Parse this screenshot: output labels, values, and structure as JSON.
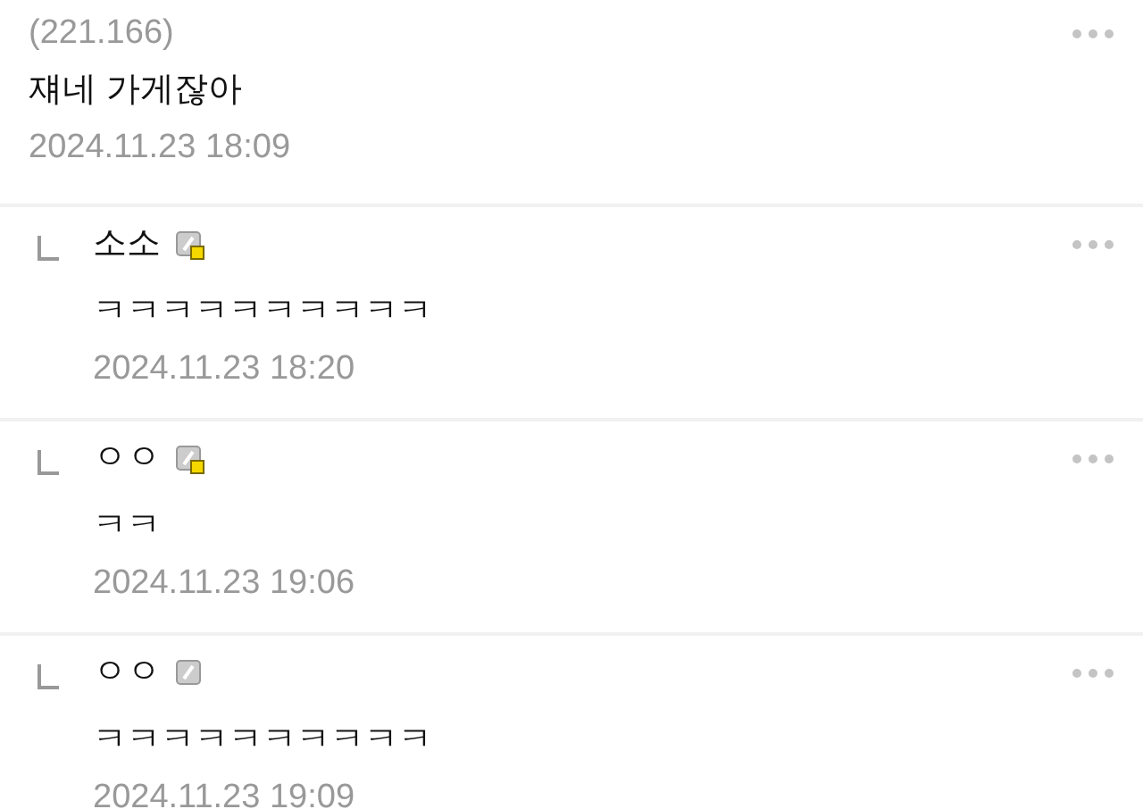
{
  "post": {
    "ip": "(221.166)",
    "text": "쟤네 가게잖아",
    "date": "2024.11.23 18:09"
  },
  "replies": [
    {
      "author": "소소",
      "fixed_nick": true,
      "text": "ㅋㅋㅋㅋㅋㅋㅋㅋㅋㅋ",
      "date": "2024.11.23 18:20"
    },
    {
      "author": "ㅇㅇ",
      "fixed_nick": true,
      "text": "ㅋㅋ",
      "date": "2024.11.23 19:06"
    },
    {
      "author": "ㅇㅇ",
      "fixed_nick": false,
      "text": "ㅋㅋㅋㅋㅋㅋㅋㅋㅋㅋ",
      "date": "2024.11.23 19:09"
    }
  ]
}
